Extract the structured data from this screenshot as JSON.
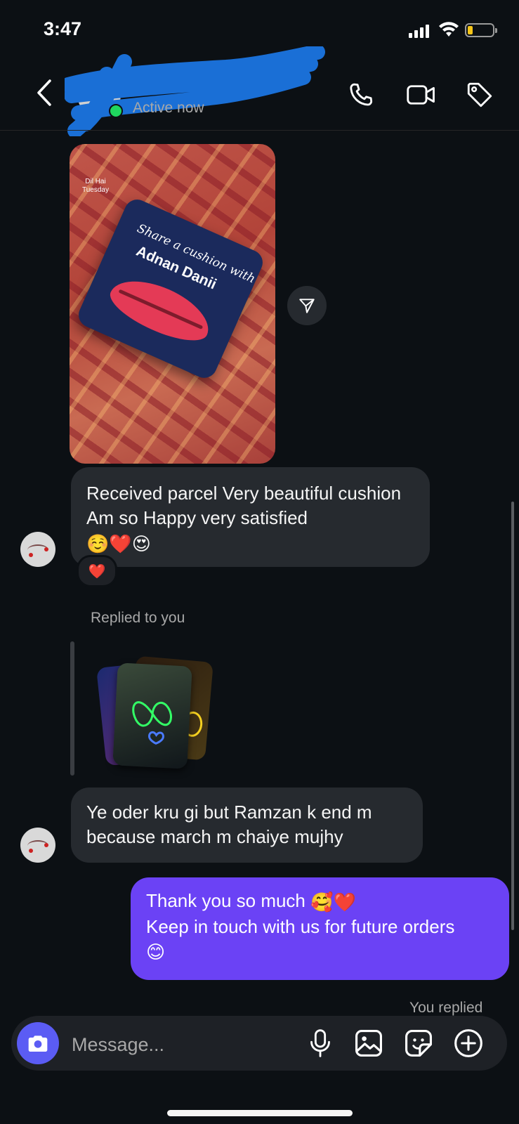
{
  "status_bar": {
    "time": "3:47",
    "battery_color": "#f5c518"
  },
  "header": {
    "name": "",
    "status": "Active now",
    "icons": [
      "back-chevron-icon",
      "phone-icon",
      "video-camera-icon",
      "tag-icon"
    ]
  },
  "messages": {
    "image_message": {
      "watermark_line1": "Dil Hai",
      "watermark_line2": "Tuesday",
      "cushion_line1": "Share a cushion with",
      "cushion_line2": "Adnan Danii"
    },
    "received_1": {
      "text": "Received parcel Very beautiful cushion Am so Happy very satisfied",
      "emojis": "☺️❤️😍",
      "reaction": "❤️"
    },
    "story_reply_label": "Replied to you",
    "received_2": {
      "text": "Ye oder kru gi but Ramzan k end m because march m chaiye mujhy"
    },
    "sent_1": {
      "line1": "Thank you so much",
      "line1_emojis": "🥰❤️",
      "line2": "Keep in touch with us for future orders",
      "line3_emoji": "😊"
    },
    "you_replied_label": "You replied"
  },
  "composer": {
    "placeholder": "Message...",
    "icons": [
      "camera-icon",
      "microphone-icon",
      "gallery-icon",
      "sticker-icon",
      "add-circle-icon"
    ]
  },
  "colors": {
    "background": "#0c1014",
    "incoming_bubble": "#262a2f",
    "outgoing_bubble": "#6b42f5",
    "active": "#1fd65f",
    "camera_button": "#5b5cf4"
  }
}
